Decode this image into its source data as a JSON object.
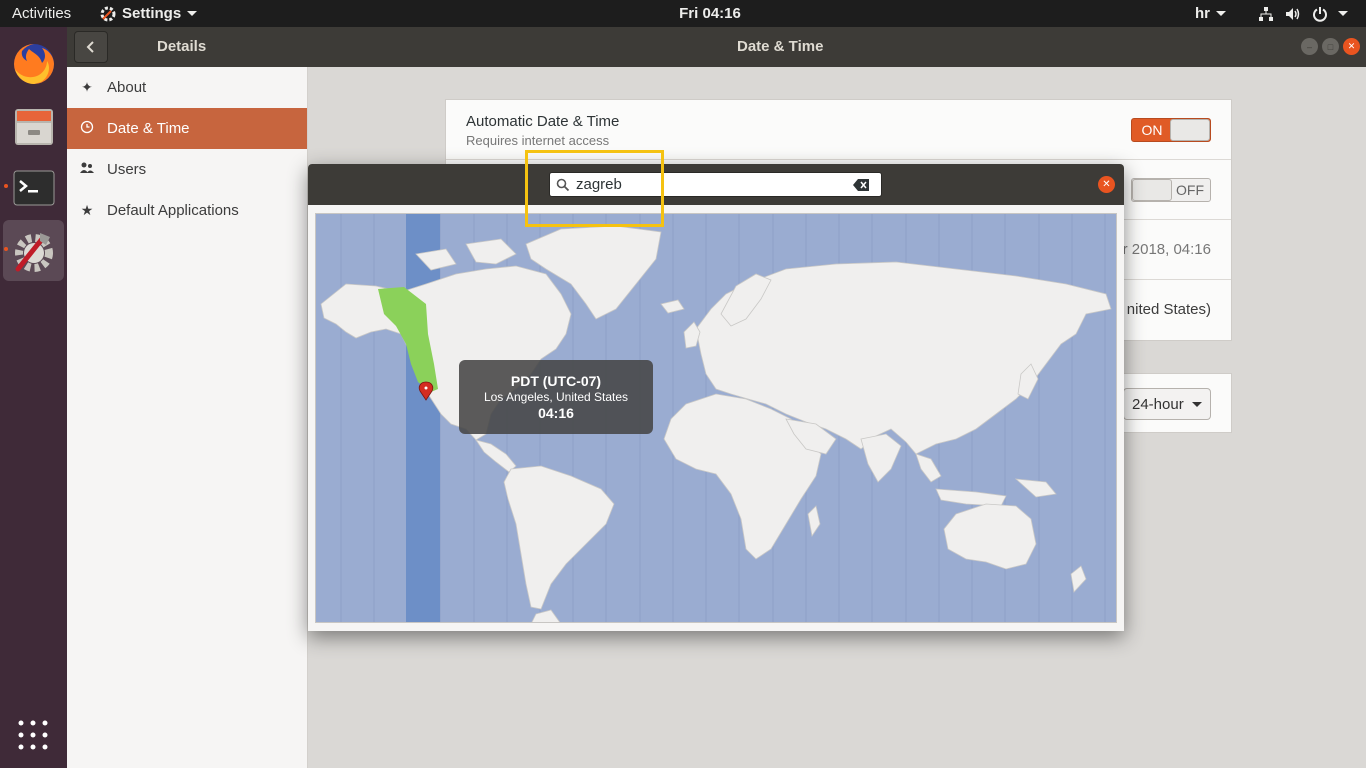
{
  "topbar": {
    "activities": "Activities",
    "app_name": "Settings",
    "clock": "Fri 04:16",
    "input_lang": "hr"
  },
  "dock": {
    "apps": [
      "firefox-icon",
      "files-icon",
      "terminal-icon",
      "settings-icon"
    ],
    "show_apps": "apps-grid-icon"
  },
  "header": {
    "sidebar_title": "Details",
    "main_title": "Date & Time"
  },
  "sidebar": {
    "items": [
      {
        "label": "About",
        "icon": "sparkle-icon"
      },
      {
        "label": "Date & Time",
        "icon": "clock-icon",
        "selected": true
      },
      {
        "label": "Users",
        "icon": "users-icon"
      },
      {
        "label": "Default Applications",
        "icon": "star-icon"
      }
    ]
  },
  "settings": {
    "auto_datetime": {
      "title": "Automatic Date & Time",
      "subtitle": "Requires internet access",
      "state": "ON"
    },
    "auto_timezone": {
      "state": "OFF"
    },
    "datetime_value": "er 2018, 04:16",
    "timezone_value": "nited States)",
    "time_format": "24-hour"
  },
  "dialog": {
    "search_value": "zagreb",
    "tooltip": {
      "zone": "PDT (UTC-07)",
      "city": "Los Angeles, United States",
      "time": "04:16"
    }
  },
  "colors": {
    "accent": "#e95420",
    "selected_sidebar": "#c7653e",
    "ocean": "#9aacd1",
    "land": "#f0efee",
    "highlight_band": "#6d8fc7",
    "zone_highlight": "#8bd15a",
    "annotation": "#f5c211"
  }
}
